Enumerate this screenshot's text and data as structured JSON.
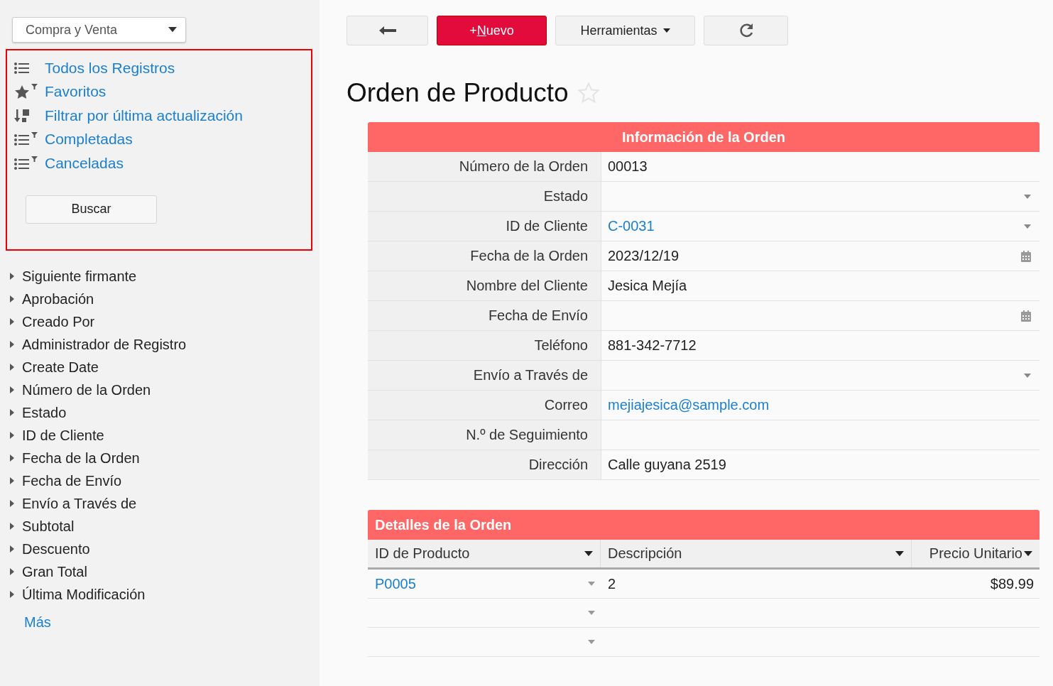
{
  "sidebar": {
    "app_selector": {
      "value": "Compra y Venta"
    },
    "views": [
      {
        "label": "Todos los Registros",
        "kind": "list"
      },
      {
        "label": "Favoritos",
        "kind": "star-filter"
      },
      {
        "label": "Filtrar por última actualización",
        "kind": "sort"
      },
      {
        "label": "Completadas",
        "kind": "list-filter"
      },
      {
        "label": "Canceladas",
        "kind": "list-filter"
      }
    ],
    "search_button": "Buscar",
    "fields": [
      {
        "label": "Siguiente firmante",
        "expanded": false
      },
      {
        "label": "Aprobación",
        "expanded": false
      },
      {
        "label": "Creado Por",
        "expanded": false
      },
      {
        "label": "Administrador de Registro",
        "expanded": false
      },
      {
        "label": "Create Date",
        "expanded": false
      },
      {
        "label": "Número de la Orden",
        "expanded": false
      },
      {
        "label": "Estado",
        "expanded": false
      },
      {
        "label": "ID de Cliente",
        "expanded": false
      },
      {
        "label": "Fecha de la Orden",
        "expanded": false
      },
      {
        "label": "Fecha de Envío",
        "expanded": false
      },
      {
        "label": "Envío a Través de",
        "expanded": false
      },
      {
        "label": "Subtotal",
        "expanded": false
      },
      {
        "label": "Descuento",
        "expanded": false
      },
      {
        "label": "Gran Total",
        "expanded": false
      },
      {
        "label": "Última Modificación",
        "expanded": false
      }
    ],
    "more_link": "Más"
  },
  "toolbar": {
    "new_button": {
      "prefix": "+",
      "access_key": "N",
      "rest": "uevo"
    },
    "tools_button": "Herramientas"
  },
  "page_title": "Orden de Producto",
  "favorite": false,
  "order_info": {
    "title": "Información de la Orden",
    "fields": [
      {
        "label": "Número de la Orden",
        "value": "00013",
        "kind": "text",
        "link": false
      },
      {
        "label": "Estado",
        "kind": "select"
      },
      {
        "label": "ID de Cliente",
        "value": "C-0031",
        "kind": "select",
        "link": true
      },
      {
        "label": "Fecha de la Orden",
        "value": "2023/12/19",
        "kind": "date",
        "link": false
      },
      {
        "label": "Nombre del Cliente",
        "value": "Jesica Mejía",
        "kind": "text",
        "link": false
      },
      {
        "label": "Fecha de Envío",
        "kind": "date"
      },
      {
        "label": "Teléfono",
        "value": "881-342-7712",
        "kind": "text",
        "link": false
      },
      {
        "label": "Envío a Través de",
        "kind": "select"
      },
      {
        "label": "Correo",
        "value": "mejiajesica@sample.com",
        "kind": "text",
        "link": true
      },
      {
        "label": "N.º de Seguimiento",
        "kind": "text"
      },
      {
        "label": "Dirección",
        "value": "Calle guyana 2519",
        "kind": "text",
        "link": false
      }
    ]
  },
  "order_details": {
    "title": "Detalles de la Orden",
    "columns": [
      "ID de Producto",
      "Descripción",
      "Precio Unitario"
    ],
    "rows": [
      {
        "product_id": "P0005",
        "description": "2",
        "unit_price": "$89.99"
      },
      {},
      {}
    ]
  }
}
